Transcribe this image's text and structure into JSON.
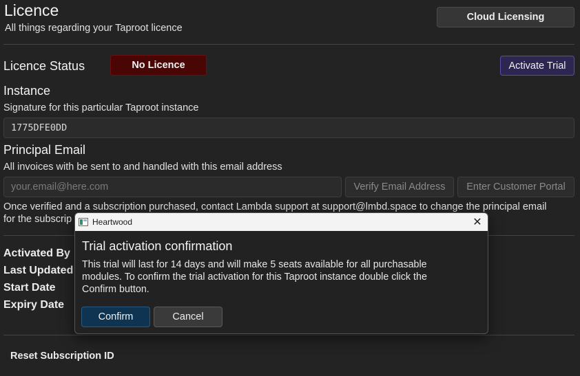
{
  "header": {
    "title": "Licence",
    "subtitle": "All things regarding your Taproot licence",
    "cloud_button": "Cloud Licensing"
  },
  "status": {
    "label": "Licence Status",
    "badge": "No Licence",
    "badge_color": "#4a0505",
    "activate_button": "Activate Trial"
  },
  "instance": {
    "heading": "Instance",
    "description": "Signature for this particular Taproot instance",
    "value": "1775DFE0DD"
  },
  "principal": {
    "heading": "Principal Email",
    "description": "All invoices with be sent to and handled with this email address",
    "placeholder": "your.email@here.com",
    "verify_button": "Verify Email Address",
    "portal_button": "Enter Customer Portal",
    "note_line1": "Once verified and a subscription purchased, contact Lambda support at support@lmbd.space to change the principal email",
    "note_line2": "for the subscrip"
  },
  "details": {
    "activated_by": "Activated By",
    "last_updated": "Last Updated",
    "start_date": "Start Date",
    "expiry_date": "Expiry Date"
  },
  "reset_label": "Reset Subscription ID",
  "dialog": {
    "app_name": "Heartwood",
    "close_glyph": "✕",
    "heading": "Trial activation confirmation",
    "body_line1": "This trial will last for 14 days and will make 5 seats available for all purchasable",
    "body_line2": "modules. To confirm the trial activation for this Taproot instance double click the",
    "body_line3": "Confirm button.",
    "confirm_button": "Confirm",
    "cancel_button": "Cancel",
    "confirm_color": "#0f3452"
  },
  "icons": {
    "app": "app-window-icon",
    "close": "close-icon"
  }
}
